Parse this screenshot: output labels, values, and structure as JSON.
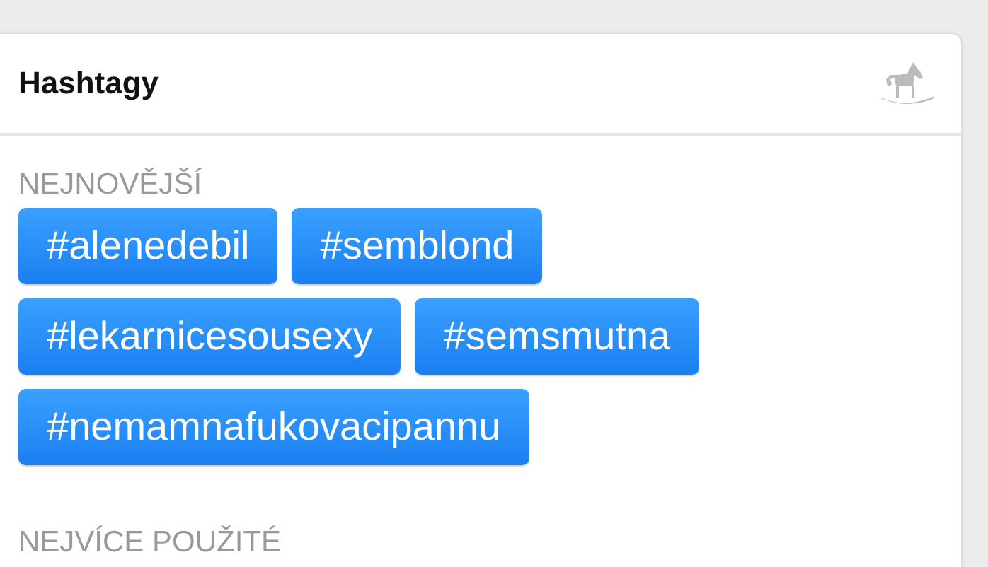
{
  "card": {
    "title": "Hashtagy"
  },
  "sections": [
    {
      "title": "NEJNOVĚJŠÍ",
      "tags": [
        "#alenedebil",
        "#semblond",
        "#lekarnicesousexy",
        "#semsmutna",
        "#nemamnafukovacipannu"
      ]
    },
    {
      "title": "NEJVÍCE POUŽITÉ"
    }
  ]
}
